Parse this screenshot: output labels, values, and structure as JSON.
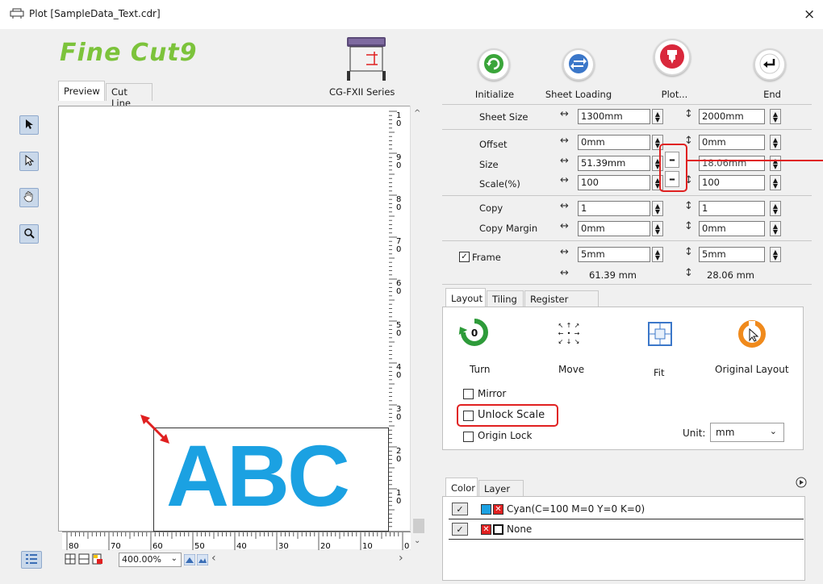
{
  "window": {
    "title": "Plot [SampleData_Text.cdr]",
    "close_glyph": "×"
  },
  "logo": {
    "text": "Fine Cut",
    "version": "9"
  },
  "device": {
    "label": "CG-FXII Series"
  },
  "preview_tabs": [
    {
      "label": "Preview",
      "active": true
    },
    {
      "label": "Cut Line",
      "active": false
    }
  ],
  "tools": [
    "select-arrow-icon",
    "node-arrow-icon",
    "hand-icon",
    "zoom-icon"
  ],
  "preview": {
    "text": "ABC",
    "text_color": "#1ba1e2"
  },
  "hruler": {
    "labels": [
      "80",
      "70",
      "60",
      "50",
      "40",
      "30",
      "20",
      "10",
      "0"
    ]
  },
  "vruler": {
    "labels": [
      [
        "1",
        "0"
      ],
      [
        "9",
        "0"
      ],
      [
        "8",
        "0"
      ],
      [
        "7",
        "0"
      ],
      [
        "6",
        "0"
      ],
      [
        "5",
        "0"
      ],
      [
        "4",
        "0"
      ],
      [
        "3",
        "0"
      ],
      [
        "2",
        "0"
      ],
      [
        "1",
        "0"
      ],
      [
        "0",
        ""
      ]
    ]
  },
  "zoom": {
    "value": "400.00%"
  },
  "actions": [
    {
      "label": "Initialize",
      "icon": "initialize-icon"
    },
    {
      "label": "Sheet Loading",
      "icon": "sheet-loading-icon"
    },
    {
      "label": "Plot...",
      "icon": "plot-icon"
    },
    {
      "label": "End",
      "icon": "end-icon"
    }
  ],
  "settings": {
    "sheet_size": {
      "label": "Sheet Size",
      "h": "1300mm",
      "v": "2000mm"
    },
    "offset": {
      "label": "Offset",
      "h": "0mm",
      "v": "0mm"
    },
    "size": {
      "label": "Size",
      "h": "51.39mm",
      "v": "18.06mm"
    },
    "scale": {
      "label": "Scale(%)",
      "h": "100",
      "v": "100"
    },
    "copy": {
      "label": "Copy",
      "h": "1",
      "v": "1"
    },
    "copy_margin": {
      "label": "Copy Margin",
      "h": "0mm",
      "v": "0mm"
    },
    "frame": {
      "label": "Frame",
      "h": "5mm",
      "v": "5mm",
      "checked": true
    },
    "totals": {
      "h": "61.39 mm",
      "v": "28.06 mm"
    },
    "lock_glyph": "–"
  },
  "layout_tabs": [
    {
      "label": "Layout",
      "active": true
    },
    {
      "label": "Tiling",
      "active": false
    },
    {
      "label": "Register Mark",
      "active": false
    }
  ],
  "layout": {
    "turn": "Turn",
    "turn_value": "0",
    "move": "Move",
    "fit": "Fit",
    "original": "Original Layout",
    "mirror": "Mirror",
    "unlock_scale": "Unlock Scale",
    "origin_lock": "Origin Lock",
    "unit_label": "Unit:",
    "unit_value": "mm"
  },
  "color_tabs": [
    {
      "label": "Color",
      "active": true
    },
    {
      "label": "Layer",
      "active": false
    }
  ],
  "color_rows": [
    {
      "label": "Cyan(C=100 M=0 Y=0 K=0)",
      "swatch": "#1ba1e2"
    },
    {
      "label": "None",
      "swatch": "#111111"
    }
  ]
}
